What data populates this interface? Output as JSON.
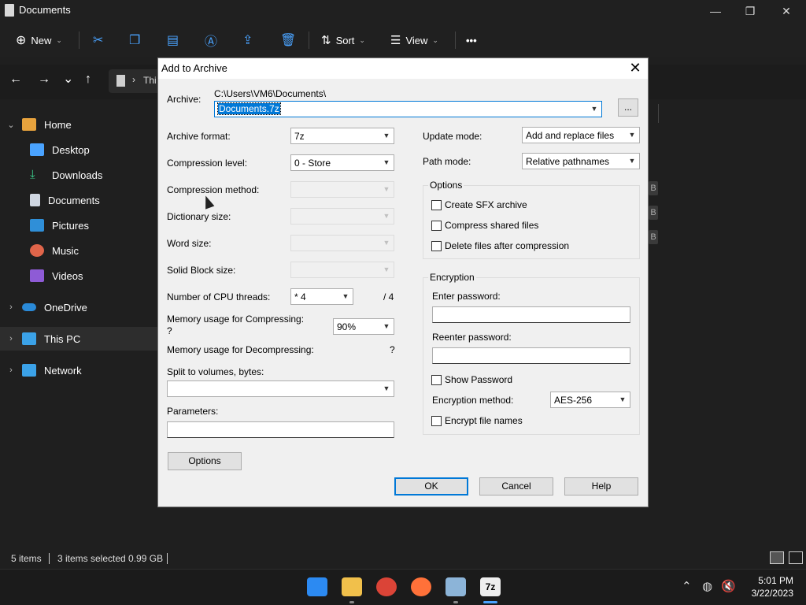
{
  "window": {
    "title": "Documents",
    "minimize": "—",
    "maximize": "❐",
    "close": "✕"
  },
  "toolbar": {
    "new_label": "New",
    "sort_label": "Sort",
    "view_label": "View",
    "more": "•••"
  },
  "nav": {
    "back": "←",
    "forward": "→",
    "recent": "⌄",
    "up": "↑",
    "address_fragment": "Thi"
  },
  "sidebar": {
    "items": [
      {
        "label": "Home"
      },
      {
        "label": "Desktop"
      },
      {
        "label": "Downloads"
      },
      {
        "label": "Documents"
      },
      {
        "label": "Pictures"
      },
      {
        "label": "Music"
      },
      {
        "label": "Videos"
      },
      {
        "label": "OneDrive"
      },
      {
        "label": "This PC"
      },
      {
        "label": "Network"
      }
    ]
  },
  "background_fragments": [
    "B",
    "B",
    "B"
  ],
  "status": {
    "items": "5 items",
    "selected": "3 items selected  0.99 GB"
  },
  "clock": {
    "time": "5:01 PM",
    "date": "3/22/2023"
  },
  "dialog": {
    "title": "Add to Archive",
    "archive_label": "Archive:",
    "archive_path": "C:\\Users\\VM6\\Documents\\",
    "archive_name": "Documents.7z",
    "browse": "...",
    "format_label": "Archive format:",
    "format_value": "7z",
    "level_label": "Compression level:",
    "level_value": "0 - Store",
    "method_label": "Compression method:",
    "dict_label": "Dictionary size:",
    "word_label": "Word size:",
    "solid_label": "Solid Block size:",
    "threads_label": "Number of CPU threads:",
    "threads_value": "* 4",
    "threads_max": "/ 4",
    "mem_comp_label": "Memory usage for Compressing:",
    "mem_comp_q": "?",
    "mem_comp_value": "90%",
    "mem_decomp_label": "Memory usage for Decompressing:",
    "mem_decomp_value": "?",
    "split_label": "Split to volumes, bytes:",
    "params_label": "Parameters:",
    "options_button": "Options",
    "update_label": "Update mode:",
    "update_value": "Add and replace files",
    "path_label": "Path mode:",
    "path_value": "Relative pathnames",
    "options_group": "Options",
    "sfx": "Create SFX archive",
    "shared": "Compress shared files",
    "delete": "Delete files after compression",
    "enc_group": "Encryption",
    "enter_pw": "Enter password:",
    "reenter_pw": "Reenter password:",
    "show_pw": "Show Password",
    "enc_method_label": "Encryption method:",
    "enc_method_value": "AES-256",
    "enc_names": "Encrypt file names",
    "ok": "OK",
    "cancel": "Cancel",
    "help": "Help"
  }
}
